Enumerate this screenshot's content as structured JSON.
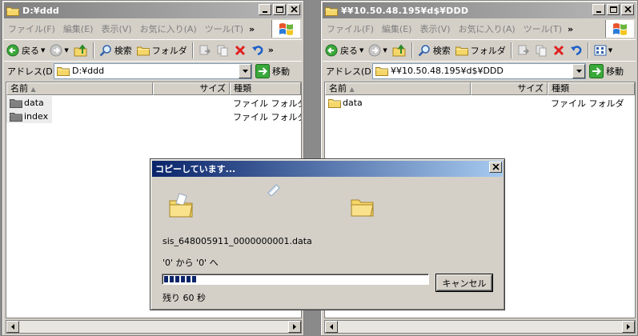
{
  "left_window": {
    "title": "D:¥ddd",
    "menu": [
      "ファイル(F)",
      "編集(E)",
      "表示(V)",
      "お気に入り(A)",
      "ツール(T)"
    ],
    "menu_more": "»",
    "toolbar": {
      "back_label": "戻る",
      "search_label": "検索",
      "folders_label": "フォルダ",
      "more": "»"
    },
    "address_label": "アドレス(D)",
    "address_value": "D:¥ddd",
    "go_label": "移動",
    "columns": {
      "name": "名前",
      "size": "サイズ",
      "type": "種類"
    },
    "items": [
      {
        "name": "data",
        "type": "ファイル フォルダ"
      },
      {
        "name": "index",
        "type": "ファイル フォルダ"
      }
    ]
  },
  "right_window": {
    "title": "¥¥10.50.48.195¥d$¥DDD",
    "menu": [
      "ファイル(F)",
      "編集(E)",
      "表示(V)",
      "お気に入り(A)",
      "ツール(T)"
    ],
    "menu_more": "»",
    "toolbar": {
      "back_label": "戻る",
      "search_label": "検索",
      "folders_label": "フォルダ"
    },
    "address_label": "アドレス(D)",
    "address_value": "¥¥10.50.48.195¥d$¥DDD",
    "go_label": "移動",
    "columns": {
      "name": "名前",
      "size": "サイズ",
      "type": "種類"
    },
    "items": [
      {
        "name": "data",
        "type": "ファイル フォルダ"
      }
    ]
  },
  "dialog": {
    "title": "コピーしています...",
    "filename": "sis_648005911_0000000001.data",
    "from_to": "'0' から '0' へ",
    "progress_percent": 14,
    "cancel_label": "キャンセル",
    "time_remaining": "残り 60 秒"
  },
  "colors": {
    "title_inactive": "#808080",
    "title_active": "#0a246a",
    "face": "#d4d0c8",
    "progress": "#0a246a"
  }
}
